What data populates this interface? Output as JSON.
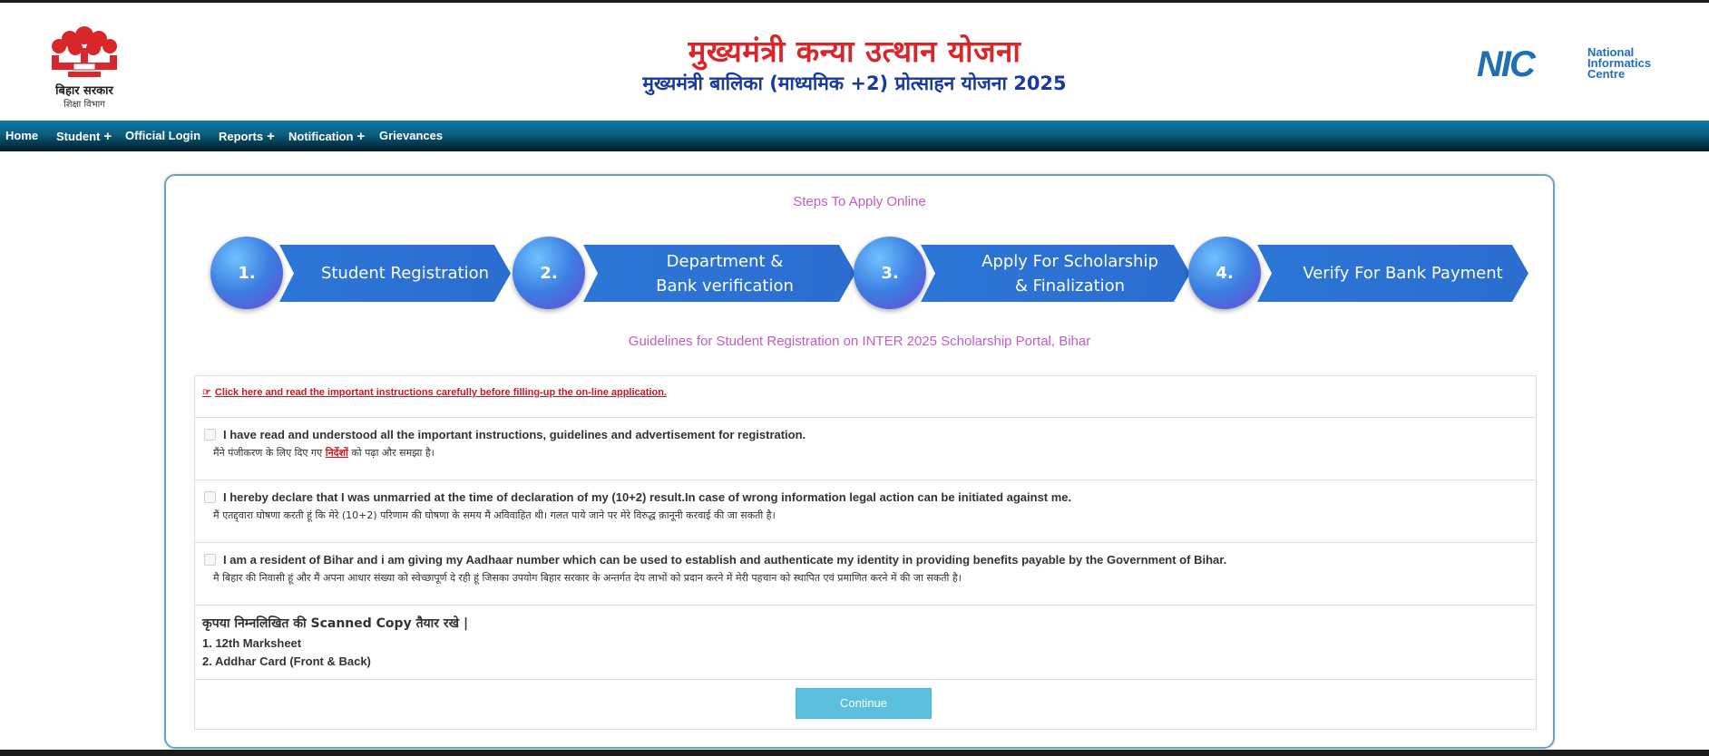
{
  "header": {
    "emblem_caption": "बिहार सरकार",
    "emblem_subcaption": "शिक्षा विभाग",
    "title_main": "मुख्यमंत्री कन्या उत्थान योजना",
    "title_sub": "मुख्यमंत्री बालिका (माध्यमिक +2) प्रोत्साहन योजना 2025",
    "nic_mark": "NIC",
    "nic_line1": "National",
    "nic_line2": "Informatics",
    "nic_line3": "Centre"
  },
  "nav": {
    "items": [
      {
        "label": "Home"
      },
      {
        "label": "Student",
        "has_submenu": true
      },
      {
        "label": "Official Login"
      },
      {
        "label": "Reports",
        "has_submenu": true
      },
      {
        "label": "Notification",
        "has_submenu": true
      },
      {
        "label": "Grievances"
      }
    ],
    "plus_symbol": "+"
  },
  "steps": {
    "title": "Steps To Apply Online",
    "items": [
      {
        "number": "1.",
        "label_line1": "Student Registration",
        "label_line2": ""
      },
      {
        "number": "2.",
        "label_line1": "Department &",
        "label_line2": "Bank verification"
      },
      {
        "number": "3.",
        "label_line1": "Apply For Scholarship",
        "label_line2": "& Finalization"
      },
      {
        "number": "4.",
        "label_line1": "Verify For Bank Payment",
        "label_line2": ""
      }
    ]
  },
  "guidelines": {
    "title": "Guidelines for Student Registration on INTER 2025 Scholarship Portal, Bihar",
    "instructions_link": "Click here and read the important instructions carefully before filling-up the on-line application.",
    "declarations": [
      {
        "en": "I have read and understood all the important instructions, guidelines and advertisement for registration.",
        "hi_before": "मैंने पंजीकरण के लिए दिए गए ",
        "hi_link": "निर्देशों",
        "hi_after": " को पढ़ा और समझा है।"
      },
      {
        "en": "I hereby declare that I was unmarried at the time of declaration of my (10+2) result.In case of wrong information legal action can be initiated against me.",
        "hi_before": "मैं एतद्द्वारा घोषणा करती हूं कि मेरे (10+2) परिणाम की घोषणा के समय मैं अविवाहित थी। गलत पाये जाने पर मेरे विरुद्ध क़ानूनी करवाई की जा सकती है।",
        "hi_link": "",
        "hi_after": ""
      },
      {
        "en": "I am a resident of Bihar and i am giving my Aadhaar number which can be used to establish and authenticate my identity in providing benefits payable by the Government of Bihar.",
        "hi_before": "मै बिहार की निवासी हूं और मैं अपना आधार संख्या को स्वेच्छापूर्ण दे रही हूं जिसका उपयोग बिहार सरकार के अन्तर्गत देय लाभों को प्रदान करने में मेरी पहचान को स्थापित एवं प्रमाणित करने में की जा सकती है।",
        "hi_link": "",
        "hi_after": ""
      }
    ],
    "docs_heading": "कृपया निम्नलिखित की Scanned Copy तैयार रखे |",
    "docs": [
      "1. 12th Marksheet",
      "2. Addhar Card (Front & Back)"
    ],
    "continue_label": "Continue"
  },
  "colors": {
    "title_red": "#d8262b",
    "title_blue": "#1a3a9e",
    "nav_bg": "#0a5e80",
    "step_blue": "#2c76d6",
    "heading_pink": "#c25cc4",
    "link_red": "#c9181f",
    "button_cyan": "#5bc0de"
  }
}
